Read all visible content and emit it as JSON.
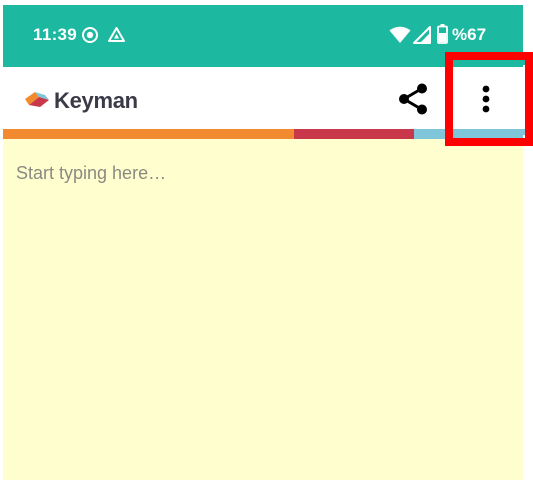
{
  "status_bar": {
    "time": "11:39",
    "battery": "%67",
    "icons": [
      "record-icon",
      "drive-icon",
      "wifi-icon",
      "signal-icon",
      "battery-icon"
    ],
    "background_color": "#1cb8a0"
  },
  "app_bar": {
    "logo_text": "Keyman",
    "share_icon": "share-icon",
    "menu_icon": "more-vertical-icon"
  },
  "stripe_colors": [
    "#f28a30",
    "#c8374a",
    "#7fc6da"
  ],
  "text_area": {
    "placeholder": "Start typing here…",
    "value": "",
    "background_color": "#fffece"
  },
  "highlight": {
    "target": "more-vertical-icon",
    "color": "#ff0000"
  }
}
